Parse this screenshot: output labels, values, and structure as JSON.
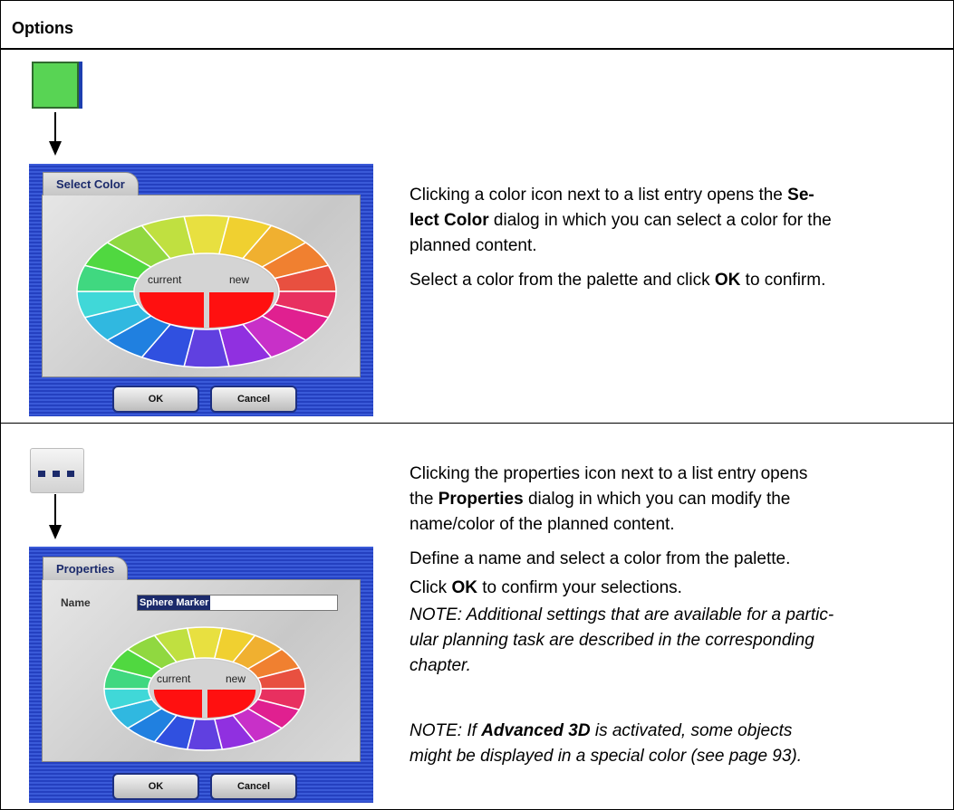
{
  "header": {
    "title": "Options"
  },
  "row1": {
    "p1_a": "Clicking a color icon next to a list entry opens the ",
    "p1_b": "Se-",
    "p1_c": "lect Color",
    "p1_d": " dialog in which you can select a color for the",
    "p1_e": "planned content.",
    "p2_a": "Select a color from the palette and click ",
    "p2_b": "OK",
    "p2_c": " to confirm.",
    "dialog": {
      "tab": "Select Color",
      "current": "current",
      "new": "new",
      "ok": "OK",
      "cancel": "Cancel"
    }
  },
  "row2": {
    "p1_l1": "Clicking the properties icon next to a list entry opens",
    "p1_l2a": "the ",
    "p1_l2b": "Properties",
    "p1_l2c": " dialog in which you can modify the",
    "p1_l3": "name/color of the planned content.",
    "p2": "Define a name and select a color from the palette.",
    "p3_a": "Click ",
    "p3_b": "OK",
    "p3_c": " to confirm your selections.",
    "note1_l1": "NOTE: Additional settings that are available for a partic-",
    "note1_l2": "ular planning task are described in the corresponding",
    "note1_l3": "chapter.",
    "note2_a": "NOTE: If ",
    "note2_b": "Advanced 3D",
    "note2_c": " is activated, some objects",
    "note2_l2": "might be displayed in a special color (see page 93).",
    "dialog": {
      "tab": "Properties",
      "name_label": "Name",
      "name_value": "Sphere Marker",
      "current": "current",
      "new": "new",
      "ok": "OK",
      "cancel": "Cancel"
    }
  },
  "palette": [
    "#e8e040",
    "#f0d030",
    "#f0b030",
    "#f08030",
    "#e85040",
    "#e83060",
    "#e02090",
    "#c830c8",
    "#9030e0",
    "#6040e0",
    "#3050e0",
    "#2080e0",
    "#30b8e0",
    "#40d8d8",
    "#40d880",
    "#50d840",
    "#90d840",
    "#c0e040"
  ],
  "colors": {
    "current": "#ff1010",
    "new": "#ff1010"
  }
}
